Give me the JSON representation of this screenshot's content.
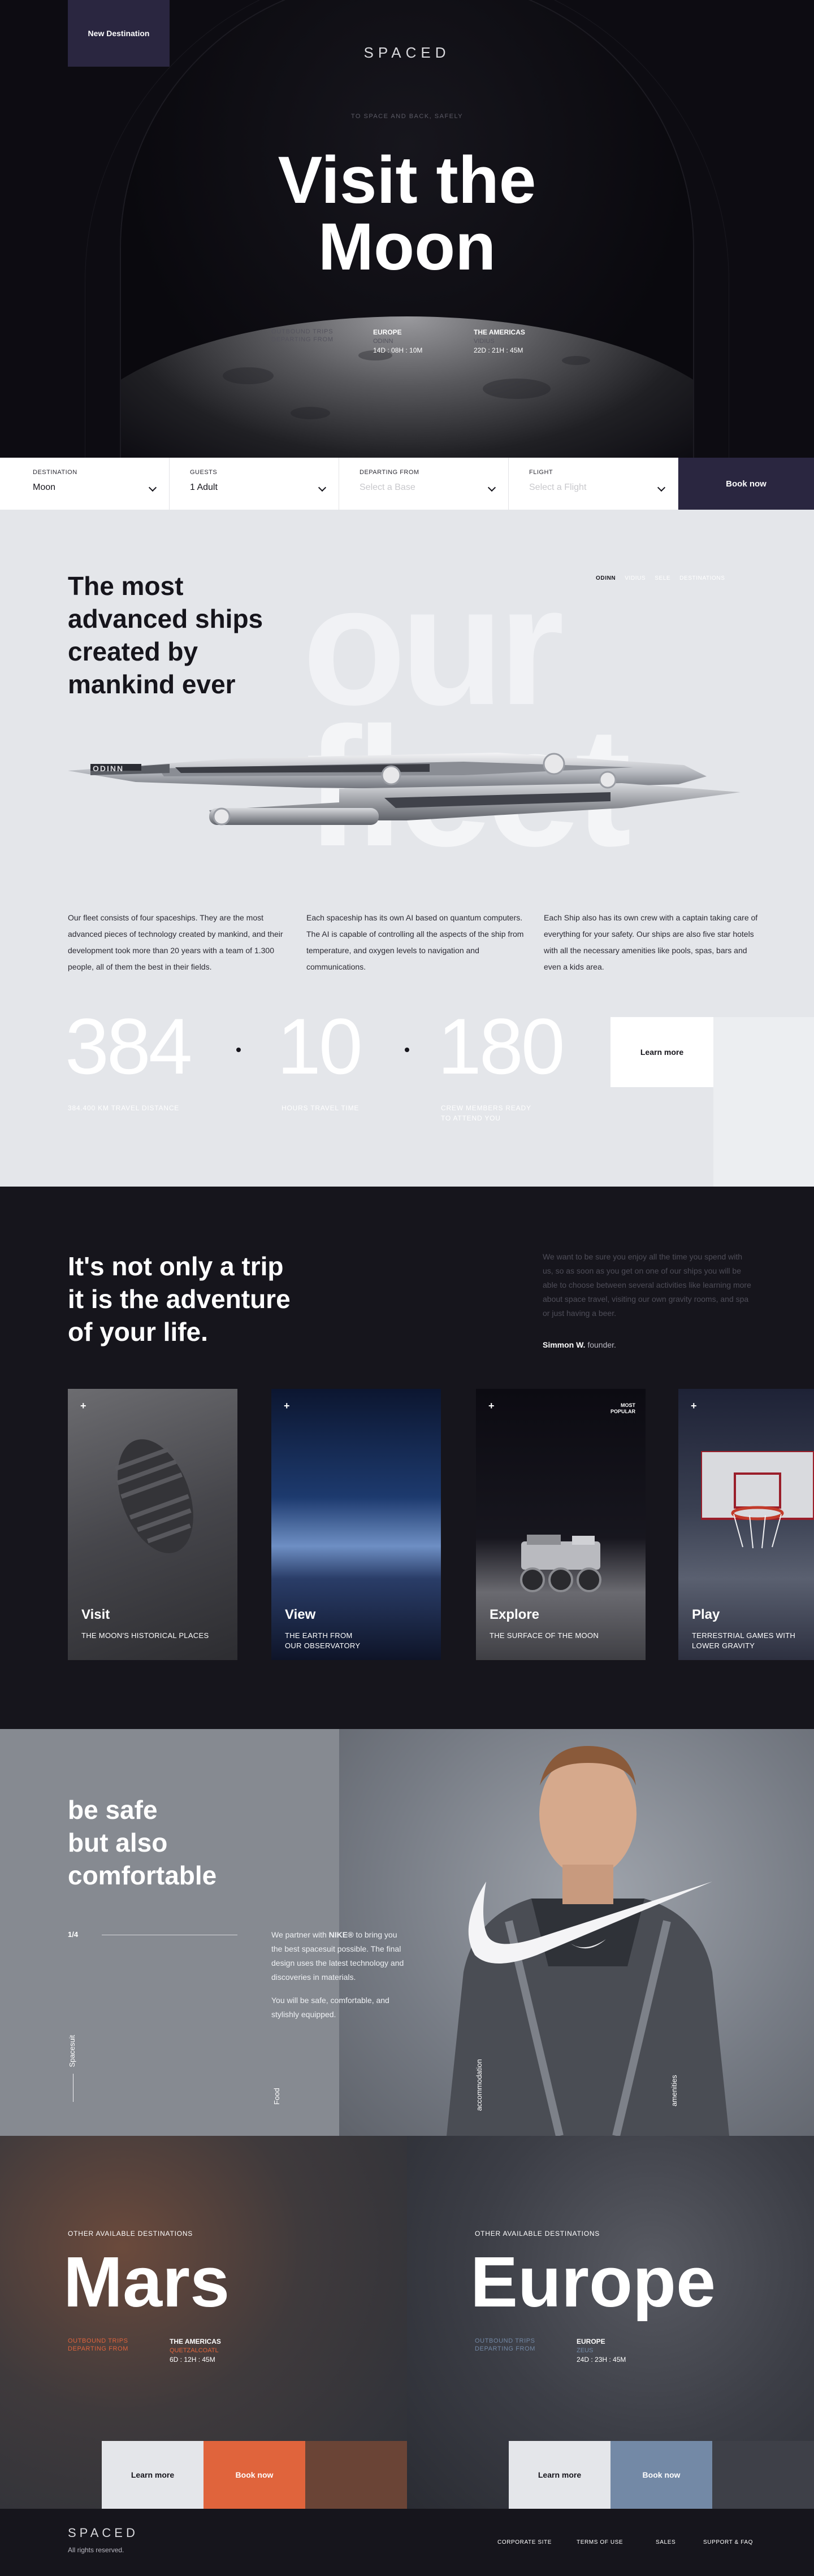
{
  "hero": {
    "badge": "New Destination",
    "brand": "SPACED",
    "kicker": "TO SPACE AND BACK, SAFELY",
    "title_line1": "Visit the",
    "title_line2": "Moon",
    "trips_label_1": "OUTBOUND TRIPS",
    "trips_label_2": "DEPARTING FROM",
    "dep1_region": "EUROPE",
    "dep1_ship": "ODINN",
    "dep1_time": "14D : 08H : 10M",
    "dep2_region": "THE AMERICAS",
    "dep2_ship": "VIDIUS",
    "dep2_time": "22D : 21H : 45M"
  },
  "booking": {
    "destination_label": "DESTINATION",
    "destination_value": "Moon",
    "guests_label": "GUESTS",
    "guests_value": "1 Adult",
    "departing_label": "DEPARTING FROM",
    "departing_placeholder": "Select a Base",
    "flight_label": "FLIGHT",
    "flight_placeholder": "Select a Flight",
    "book_label": "Book now"
  },
  "fleet": {
    "heading_1": "The most",
    "heading_2": "advanced ships",
    "heading_3": "created by",
    "heading_4": "mankind ever",
    "ghost_1": "our",
    "ghost_2": "fleet",
    "ship_tabs": [
      "ODINN",
      "VIDIUS",
      "SELE",
      "DESTINATIONS"
    ],
    "ship_name": "ODINN",
    "p1": "Our fleet consists of four spaceships. They are the most advanced pieces of technology created by mankind, and their development took more than 20 years with a team of 1.300 people, all of them the best in their fields.",
    "p2": "Each spaceship has its own AI based on quantum computers. The AI is capable of controlling all the aspects of the ship from temperature, and oxygen levels to navigation and communications.",
    "p3": "Each Ship also has its own crew with a captain taking care of everything for your safety. Our ships are also five star hotels with all the necessary amenities like pools, spas, bars and even a kids area.",
    "stat1_value": "384",
    "stat1_label": "384.400 KM TRAVEL DISTANCE",
    "stat2_value": "10",
    "stat2_label": "HOURS TRAVEL TIME",
    "stat3_value": "180",
    "stat3_label_1": "CREW MEMBERS READY",
    "stat3_label_2": "TO ATTEND YOU",
    "learn_more": "Learn more"
  },
  "adventure": {
    "heading_1": "It's not only a trip",
    "heading_2": "it is the adventure",
    "heading_3": "of your life.",
    "quote": "We want to be sure you enjoy all the time you spend with us, so as soon as you get on one of our ships you will be able to choose between several activities like learning more about space travel, visiting our own gravity rooms, and spa or just having a beer.",
    "author": "Simmon W.",
    "author_role": "founder.",
    "cards": [
      {
        "title": "Visit",
        "sub1": "THE MOON'S HISTORICAL PLACES",
        "sub2": ""
      },
      {
        "title": "View",
        "sub1": "THE EARTH FROM",
        "sub2": "OUR OBSERVATORY"
      },
      {
        "title": "Explore",
        "sub1": "THE SURFACE OF THE MOON",
        "sub2": "",
        "badge1": "MOST",
        "badge2": "POPULAR"
      },
      {
        "title": "Play",
        "sub1": "TERRESTRIAL GAMES WITH",
        "sub2": "LOWER GRAVITY"
      }
    ]
  },
  "suit": {
    "heading_1": "be safe",
    "heading_2": "but also",
    "heading_3": "comfortable",
    "counter": "1/4",
    "p1_a": "We partner with ",
    "p1_brand": "NIKE®",
    "p1_b": " to bring you the best spacesuit possible. The final design uses the latest technology and discoveries in materials.",
    "p2": "You will be safe, comfortable, and stylishly equipped.",
    "vlabel_left": "Spacesuit",
    "vlabel_food": "Food",
    "vlabel_accom": "accommodation",
    "vlabel_amen": "amenities"
  },
  "destinations": [
    {
      "kicker": "OTHER AVAILABLE DESTINATIONS",
      "name": "Mars",
      "trips_1": "OUTBOUND TRIPS",
      "trips_2": "DEPARTING FROM",
      "region": "THE AMERICAS",
      "ship": "QUETZALCOATL",
      "time": "6D : 12H : 45M",
      "learn": "Learn more",
      "book": "Book now"
    },
    {
      "kicker": "OTHER AVAILABLE DESTINATIONS",
      "name": "Europe",
      "trips_1": "OUTBOUND TRIPS",
      "trips_2": "DEPARTING FROM",
      "region": "EUROPE",
      "ship": "ZEUS",
      "time": "24D : 23H : 45M",
      "learn": "Learn more",
      "book": "Book now"
    }
  ],
  "footer": {
    "brand": "SPACED",
    "rights": "All rights reserved.",
    "links": [
      "CORPORATE SITE",
      "TERMS OF USE",
      "SALES",
      "SUPPORT & FAQ"
    ]
  },
  "colors": {
    "dark": "#16151c",
    "purple": "#2a2640",
    "orange": "#e0643c",
    "steel_blue": "#7389a6",
    "light_gray": "#e4e6ea"
  }
}
